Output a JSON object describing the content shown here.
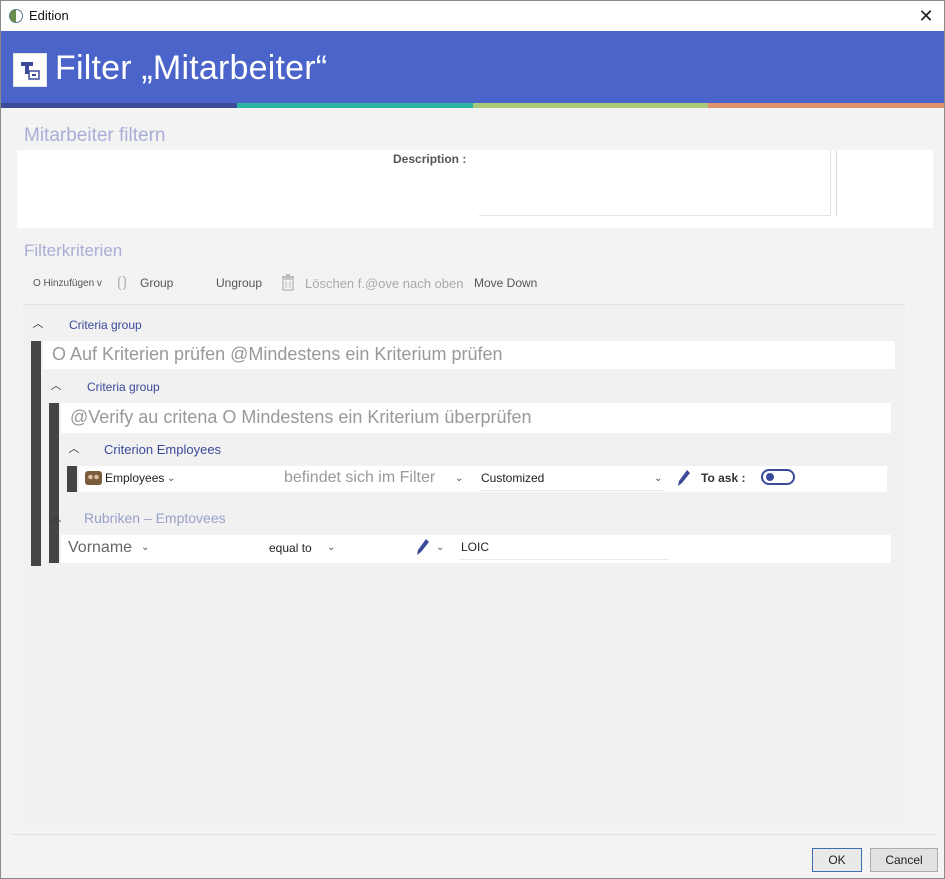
{
  "window": {
    "title": "Edition",
    "close_glyph": "✕"
  },
  "header": {
    "title": "Filter „Mitarbeiter“",
    "icon": "filter-app-icon",
    "stripe_colors": [
      "#3c4a9a",
      "#2bb3a4",
      "#a9c97a",
      "#e0926a"
    ]
  },
  "general": {
    "section_title": "Mitarbeiter filtern",
    "description_label": "Description :",
    "description_value": ""
  },
  "filter": {
    "section_title": "Filterkriterien",
    "toolbar": {
      "add_label": "O Hinzufügen v",
      "group_label": "Group",
      "ungroup_label": "Ungroup",
      "delete_label": "Löschen f.@ove nach oben",
      "move_down_label": "Move Down"
    },
    "group1": {
      "label": "Criteria group",
      "mode_text": "O Auf Kriterien prüfen @Mindestens ein Kriterium prüfen"
    },
    "group2": {
      "label": "Criteria group",
      "mode_text": "@Verify au critena O Mindestens ein Kriterium überprüfen"
    },
    "criterion_employees": {
      "label": "Criterion Employees",
      "field": "Employees",
      "operator": "befindet sich im Filter",
      "value": "Customized",
      "to_ask_label": "To ask :",
      "toggle_on": false
    },
    "rubrics": {
      "label": "Rubriken – Emptovees",
      "field": "Vorname",
      "operator": "equal to",
      "value": "LOIC"
    }
  },
  "footer": {
    "ok_label": "OK",
    "cancel_label": "Cancel"
  }
}
